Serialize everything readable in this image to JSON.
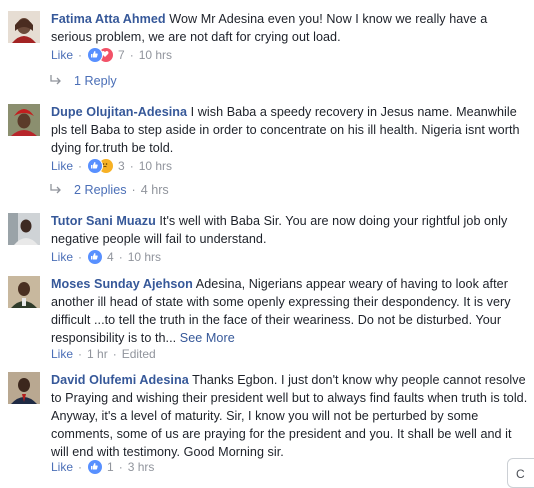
{
  "comments": [
    {
      "author": "Fatima Atta Ahmed",
      "text": "Wow Mr Adesina even you! Now I know we really have a serious problem, we are not daft for crying out load.",
      "like_label": "Like",
      "reaction_icons": [
        "like-icon",
        "love-icon"
      ],
      "reaction_count": "7",
      "time": "10 hrs",
      "replies_label": "1 Reply",
      "replies_time": ""
    },
    {
      "author": "Dupe Olujitan-Adesina",
      "text": "I wish Baba a speedy recovery in Jesus name. Meanwhile pls tell Baba to step aside in order to concentrate on his ill health. Nigeria isnt worth dying for.truth be told.",
      "like_label": "Like",
      "reaction_icons": [
        "like-icon",
        "sad-icon"
      ],
      "reaction_count": "3",
      "time": "10 hrs",
      "replies_label": "2 Replies",
      "replies_time": "4 hrs"
    },
    {
      "author": "Tutor Sani Muazu",
      "text": "It's well with Baba Sir. You are now doing your rightful job only negative people will fail to understand.",
      "like_label": "Like",
      "reaction_icons": [
        "like-icon"
      ],
      "reaction_count": "4",
      "time": "10 hrs"
    },
    {
      "author": "Moses Sunday Ajehson",
      "text": "Adesina, Nigerians appear weary of having to look after another ill head of state with some openly expressing their despondency. It is very difficult ...to tell the truth in the face of their weariness. Do not be disturbed. Your responsibility is to th...",
      "see_more": "See More",
      "like_label": "Like",
      "time": "1 hr",
      "edited": "Edited"
    },
    {
      "author": "David Olufemi Adesina",
      "text": "Thanks Egbon. I just don't know why people cannot resolve to Praying and wishing their president well but to always find faults when truth is told. Anyway, it's a level of maturity. Sir, I know you will not be perturbed by some comments, some of us are praying for the president and you. It shall be well and it will end with testimony. Good Morning sir.",
      "like_label": "Like",
      "reaction_icons": [
        "like-icon"
      ],
      "reaction_count": "1",
      "time": "3 hrs"
    }
  ],
  "corner_label": "C",
  "colors": {
    "author": "#365899",
    "like": "#4b6fb7",
    "muted": "#90949c",
    "like_reaction": "#5890ff",
    "love_reaction": "#f25268",
    "sad_reaction": "#f7b125"
  }
}
